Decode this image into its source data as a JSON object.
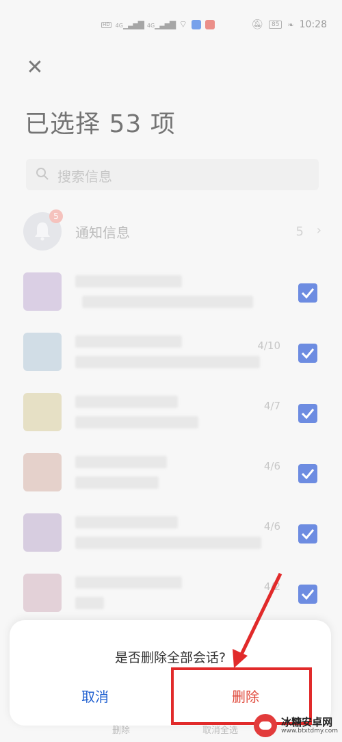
{
  "status_bar": {
    "time": "10:28",
    "battery": "85",
    "network_1": "4G",
    "network_2": "4G"
  },
  "header": {
    "title": "已选择 53 项"
  },
  "search": {
    "placeholder": "搜索信息"
  },
  "notification_row": {
    "label": "通知信息",
    "badge": "5",
    "count": "5"
  },
  "conversations": [
    {
      "date": "",
      "checked": true,
      "avatar_color": "#c7b6d6"
    },
    {
      "date": "4/10",
      "checked": true,
      "avatar_color": "#b8cbd9"
    },
    {
      "date": "4/7",
      "checked": true,
      "avatar_color": "#d9cfa7"
    },
    {
      "date": "4/6",
      "checked": true,
      "avatar_color": "#d8b8b0"
    },
    {
      "date": "4/6",
      "checked": true,
      "avatar_color": "#c2b3cf"
    },
    {
      "date": "4/2",
      "checked": true,
      "avatar_color": "#d5b8c4"
    }
  ],
  "bottom_bar": {
    "delete_label": "删除",
    "deselect_all_label": "取消全选"
  },
  "dialog": {
    "message": "是否删除全部会话?",
    "cancel_label": "取消",
    "delete_label": "删除"
  },
  "watermark": {
    "name": "冰糖安卓网",
    "url": "www.btxtdmy.com"
  },
  "colors": {
    "accent_blue": "#1f4fd1",
    "delete_red": "#e04a3c",
    "annotation_red": "#e12a2a"
  }
}
